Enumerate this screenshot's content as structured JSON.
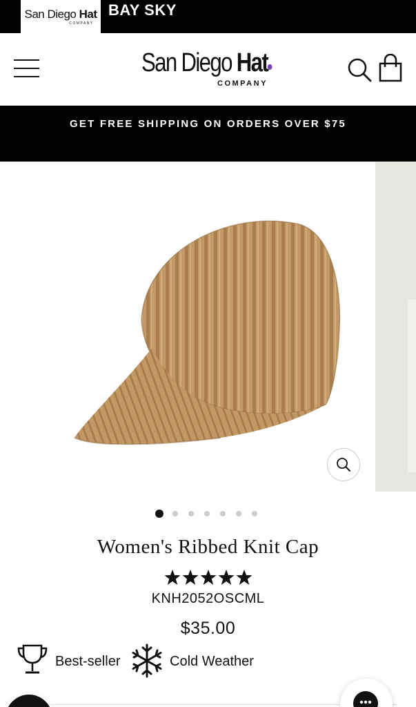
{
  "notification_bar": {
    "app_logo_word": "San Diego ",
    "app_logo_bold": "Hat",
    "app_logo_sub": "COMPANY",
    "app_name": "BAY SKY"
  },
  "header": {
    "logo_word": "San Diego ",
    "logo_bold": "Hat",
    "logo_sub": "COMPANY",
    "icons": [
      "menu-icon",
      "search-icon",
      "cart-icon"
    ]
  },
  "announcement": {
    "text": "GET FREE SHIPPING ON ORDERS OVER $75"
  },
  "gallery": {
    "slide_count": 7,
    "active_slide": 1
  },
  "product": {
    "title": "Women's Ribbed Knit Cap",
    "rating": 5,
    "rating_max": 5,
    "sku": "KNH2052OSCML",
    "price": "$35.00",
    "badges": [
      {
        "icon": "trophy-icon",
        "label": "Best-seller"
      },
      {
        "icon": "snowflake-icon",
        "label": "Cold Weather"
      }
    ]
  },
  "colors": {
    "bar_background": "#000000",
    "text": "#111111",
    "logo_accent": "#7a3fb5",
    "hat": "#c39a66"
  }
}
